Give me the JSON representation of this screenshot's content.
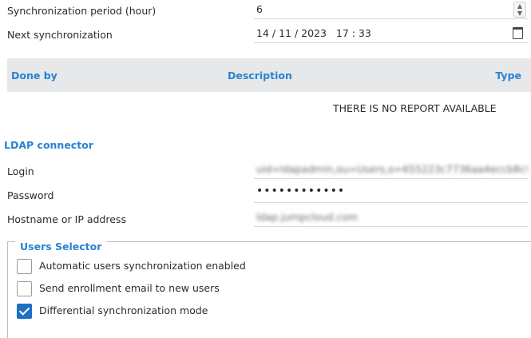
{
  "sync": {
    "period_label": "Synchronization period (hour)",
    "period_value": "6",
    "next_label": "Next synchronization",
    "next_value": "14 / 11 / 2023   17 : 33"
  },
  "report_table": {
    "columns": [
      "Done by",
      "Description",
      "Type"
    ],
    "empty_message": "THERE IS NO REPORT AVAILABLE"
  },
  "ldap": {
    "section_title": "LDAP connector",
    "login_label": "Login",
    "login_value": "uid=ldapadmin,ou=Users,o=655223c7736aa4eccb8c9e0",
    "password_label": "Password",
    "password_value": "••••••••••••",
    "host_label": "Hostname or IP address",
    "host_value": "ldap.jumpcloud.com"
  },
  "users_selector": {
    "legend": "Users Selector",
    "options": [
      {
        "label": "Automatic users synchronization enabled",
        "checked": false
      },
      {
        "label": "Send enrollment email to new users",
        "checked": false
      },
      {
        "label": "Differential synchronization mode",
        "checked": true
      }
    ]
  },
  "colors": {
    "accent": "#2a82d2",
    "header_bg": "#e7e8ea",
    "checkbox_on": "#1f6fc4"
  }
}
